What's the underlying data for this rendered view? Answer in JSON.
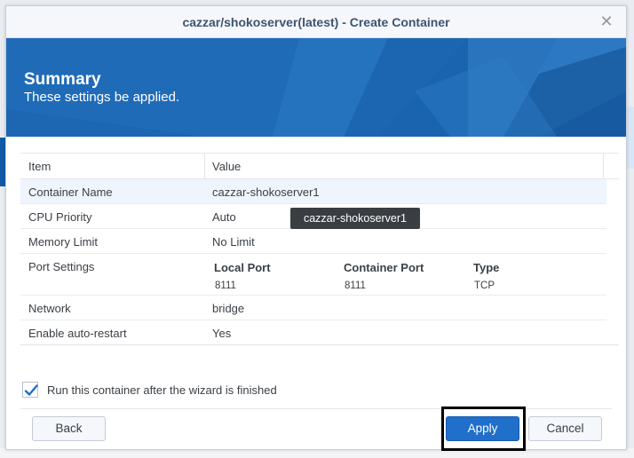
{
  "dialog": {
    "title": "cazzar/shokoserver(latest) - Create Container",
    "close_glyph": "✕"
  },
  "banner": {
    "title": "Summary",
    "subtitle": "These settings be applied."
  },
  "grid": {
    "columns": [
      "Item",
      "Value"
    ],
    "rows": [
      {
        "item": "Container Name",
        "value": "cazzar-shokoserver1",
        "selected": true
      },
      {
        "item": "CPU Priority",
        "value": "Auto"
      },
      {
        "item": "Memory Limit",
        "value": "No Limit"
      },
      {
        "item": "Network",
        "value": "bridge"
      },
      {
        "item": "Enable auto-restart",
        "value": "Yes"
      }
    ],
    "port_settings": {
      "item": "Port Settings",
      "headers": [
        "Local Port",
        "Container Port",
        "Type"
      ],
      "values": [
        "8111",
        "8111",
        "TCP"
      ]
    }
  },
  "tooltip": {
    "text": "cazzar-shokoserver1"
  },
  "run_after": {
    "label": "Run this container after the wizard is finished",
    "checked": true
  },
  "buttons": {
    "back": "Back",
    "apply": "Apply",
    "cancel": "Cancel"
  },
  "colors": {
    "accent": "#1f6fcb",
    "banner": "#1f6bb8",
    "title_text": "#3d5472",
    "highlight_border": "#000000"
  },
  "icons": {
    "close": "close-icon",
    "check": "checkmark-icon"
  }
}
